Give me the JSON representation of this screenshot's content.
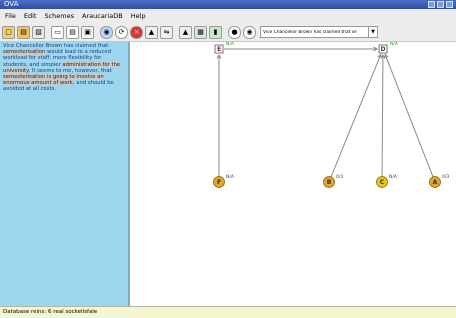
{
  "window": {
    "title": "OVA"
  },
  "menu": [
    {
      "label": "File"
    },
    {
      "label": "Edit"
    },
    {
      "label": "Schemes"
    },
    {
      "label": "AraucariaDB"
    },
    {
      "label": "Help"
    }
  ],
  "toolbar": {
    "scheme_select": {
      "value": "Vice Chancellor Brown has claimed that se"
    }
  },
  "text_panel": {
    "segments": [
      {
        "text": "Vice Chancellor Brown has claimed that ",
        "highlight": false
      },
      {
        "text": "semesterisation",
        "highlight": true
      },
      {
        "text": " would lead to a reduced workload for staff, more flexibility for students, and simpler ",
        "highlight": false
      },
      {
        "text": "administration for the university",
        "highlight": true
      },
      {
        "text": ". It seems to me, however, that ",
        "highlight": false
      },
      {
        "text": "semesterisation is going to involve an enormous amount of work",
        "highlight": true
      },
      {
        "text": ", and should be avoided at all costs.",
        "highlight": false
      }
    ]
  },
  "diagram": {
    "nodes": [
      {
        "id": "E",
        "label": "E",
        "score": "N/A",
        "color": "#ffffff",
        "stroke": "#555555",
        "shape": "rect"
      },
      {
        "id": "D",
        "label": "D",
        "score": "N/A",
        "color": "#ffffff",
        "stroke": "#555555",
        "shape": "rect"
      },
      {
        "id": "F",
        "label": "F",
        "score": "N/A",
        "color": "#e0a82a",
        "stroke": "#8a6200",
        "shape": "circle"
      },
      {
        "id": "B",
        "label": "B",
        "score": "0/3",
        "color": "#e0a82a",
        "stroke": "#8a6200",
        "shape": "circle"
      },
      {
        "id": "C",
        "label": "C",
        "score": "N/A",
        "color": "#e8c417",
        "stroke": "#8a7400",
        "shape": "circle"
      },
      {
        "id": "A",
        "label": "A",
        "score": "0/3",
        "color": "#e0a82a",
        "stroke": "#8a6200",
        "shape": "circle"
      }
    ],
    "edges": [
      {
        "from": "F",
        "to": "E"
      },
      {
        "from": "B",
        "to": "D"
      },
      {
        "from": "C",
        "to": "D"
      },
      {
        "from": "A",
        "to": "D"
      },
      {
        "from": "E",
        "to": "D"
      }
    ]
  },
  "status": {
    "text": "Database reins: 6 real sockellsfale"
  }
}
